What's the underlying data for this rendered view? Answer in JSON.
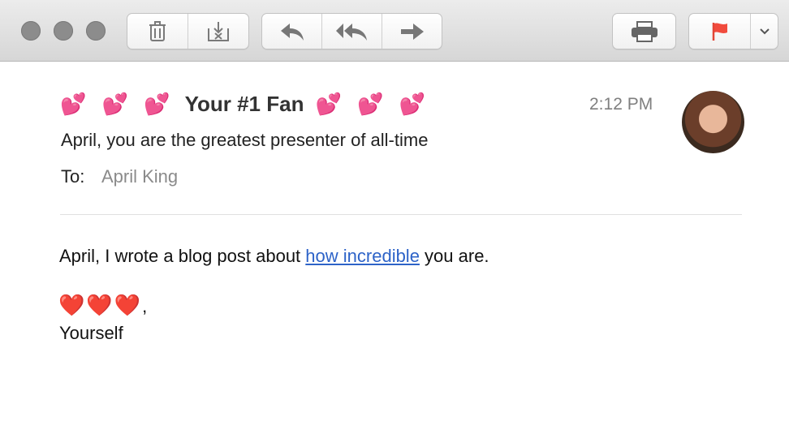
{
  "toolbar": {
    "buttons": [
      "delete",
      "junk",
      "reply",
      "reply-all",
      "forward",
      "print",
      "flag",
      "flag-menu"
    ],
    "flag_color": "#f14b3d"
  },
  "message": {
    "from_hearts_left": "💕 💕 💕",
    "from_name": "Your #1 Fan",
    "from_hearts_right": "💕 💕 💕",
    "time": "2:12 PM",
    "subject": "April, you are the greatest presenter of all-time",
    "to_label": "To:",
    "to_name": "April King"
  },
  "body": {
    "line_before_link": "April, I wrote a blog post about ",
    "link_text": "how incredible",
    "line_after_link": " you are.",
    "signoff_hearts": "❤️❤️❤️",
    "signoff_comma": ",",
    "signature": "Yourself"
  }
}
